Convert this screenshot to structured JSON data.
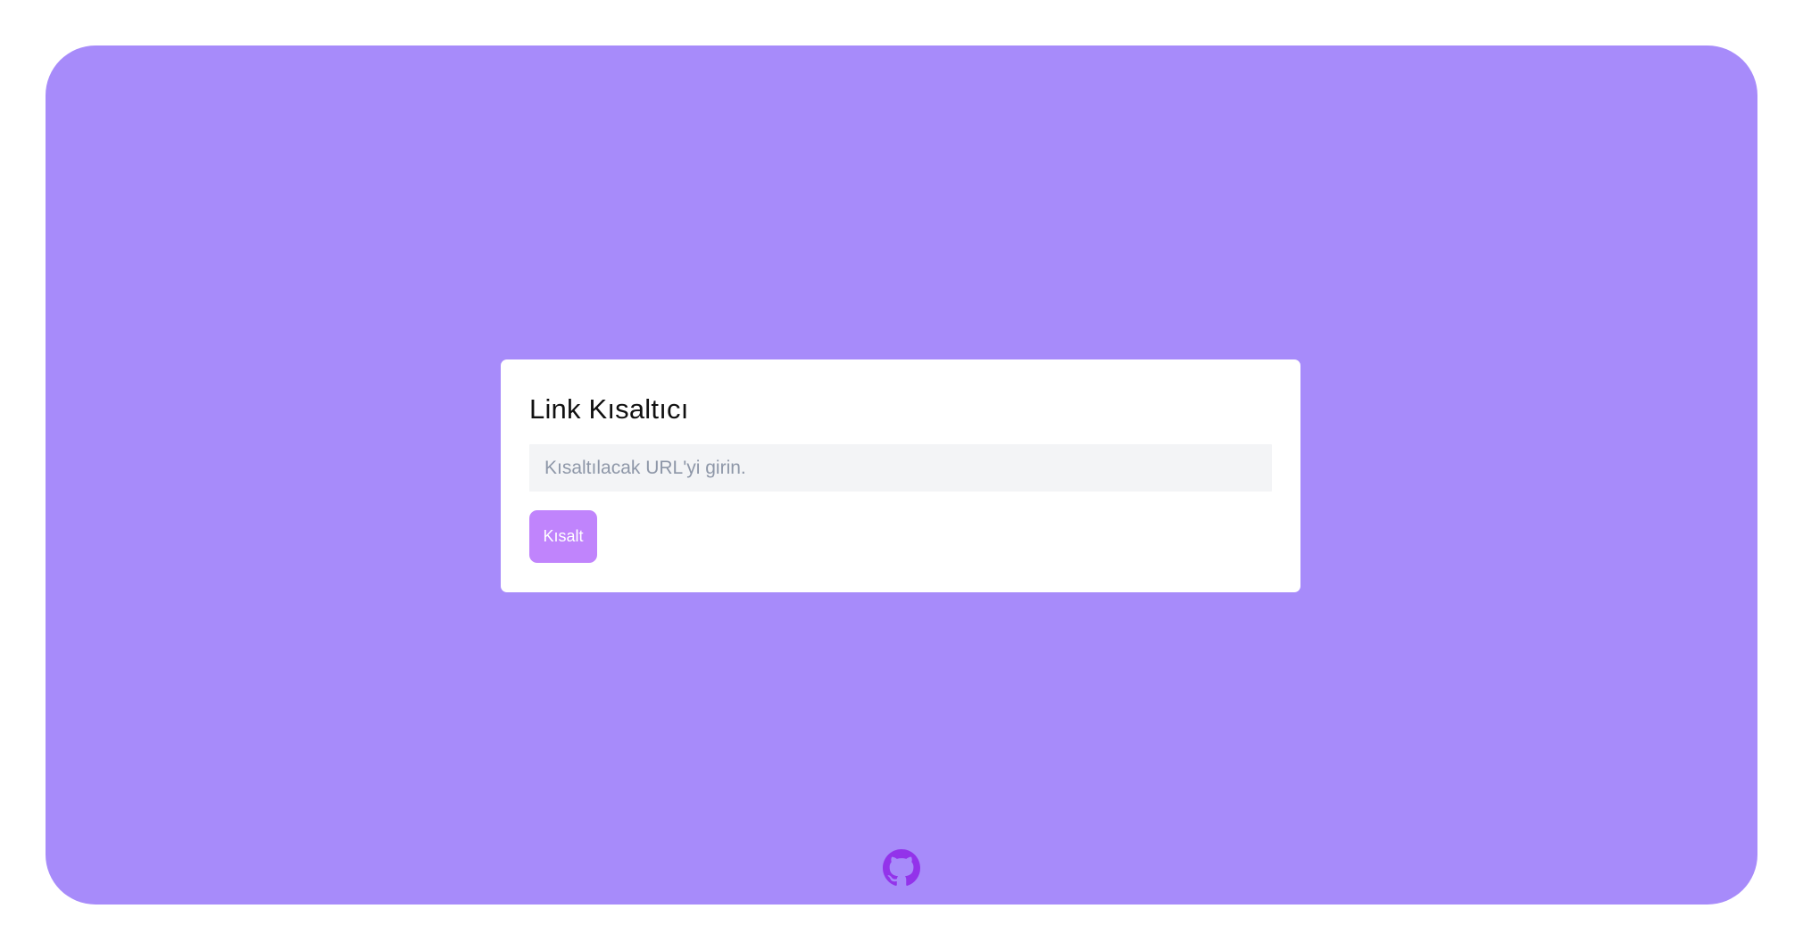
{
  "card": {
    "title": "Link Kısaltıcı",
    "input_placeholder": "Kısaltılacak URL'yi girin.",
    "input_value": "",
    "button_label": "Kısalt"
  },
  "footer": {
    "icon": "github-icon"
  },
  "colors": {
    "background_frame": "#a78bfa",
    "card": "#ffffff",
    "button": "#c084fc",
    "input_background": "#f3f4f6",
    "github_icon": "#9333ea"
  }
}
